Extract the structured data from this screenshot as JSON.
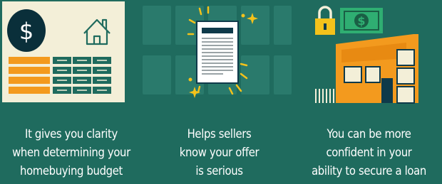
{
  "background_color": "#1f6b5e",
  "accent_colors": {
    "orange": "#f39a1e",
    "navy": "#0f3a4a",
    "cream": "#f3efd8",
    "yellow": "#f4c21b",
    "money_green": "#2fae72"
  },
  "panels": [
    {
      "icons": [
        "dollar-coin-icon",
        "house-outline-icon",
        "budget-table-icon"
      ],
      "coin_symbol": "$",
      "caption_lines": [
        "It gives you clarity",
        "when determining your",
        "homebuying budget"
      ]
    },
    {
      "icons": [
        "document-icon",
        "sparkle-icon"
      ],
      "caption_lines": [
        "Helps sellers",
        "know your offer",
        "is serious"
      ]
    },
    {
      "icons": [
        "padlock-icon",
        "dollar-bill-icon",
        "house-icon"
      ],
      "bill_symbol": "$",
      "caption_lines": [
        "You can be more",
        "confident in your",
        "ability to secure a loan"
      ]
    }
  ]
}
